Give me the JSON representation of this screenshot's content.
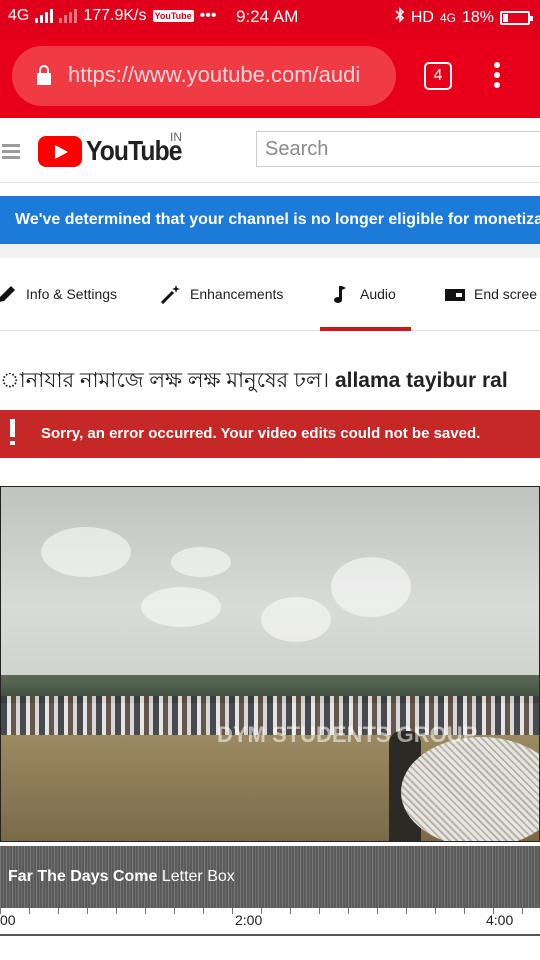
{
  "status_bar": {
    "network": "4G",
    "speed": "177.9K/s",
    "youtube_notif": "YouTube",
    "more": "•••",
    "time": "9:24 AM",
    "hd": "HD",
    "network2": "4G",
    "battery": "18%"
  },
  "browser": {
    "url": "https://www.youtube.com/audi",
    "tab_count": "4"
  },
  "header": {
    "logo_text": "YouTube",
    "country": "IN",
    "search_placeholder": "Search"
  },
  "banner": {
    "text": "We've determined that your channel is no longer eligible for monetiza"
  },
  "tabs": [
    {
      "label": "Info & Settings",
      "icon": "pencil-icon"
    },
    {
      "label": "Enhancements",
      "icon": "magic-wand-icon"
    },
    {
      "label": "Audio",
      "icon": "music-note-icon",
      "active": true
    },
    {
      "label": "End scree",
      "icon": "end-screen-icon"
    }
  ],
  "video": {
    "title_bengali": "ানাযার নামাজে লক্ষ লক্ষ মানুষের ঢল।",
    "title_latin": "allama tayibur ral",
    "watermark": "DYM STUDENTS GROUP"
  },
  "error": {
    "message": "Sorry, an error occurred. Your video edits could not be saved."
  },
  "audio_track": {
    "title": "Far The Days Come",
    "artist": "Letter Box"
  },
  "timeline": {
    "labels": [
      "00",
      "2:00",
      "4:00"
    ]
  },
  "colors": {
    "browser_red": "#e8001b",
    "banner_blue": "#1c7ad8",
    "error_red": "#c62828",
    "tab_active": "#cc181e"
  }
}
